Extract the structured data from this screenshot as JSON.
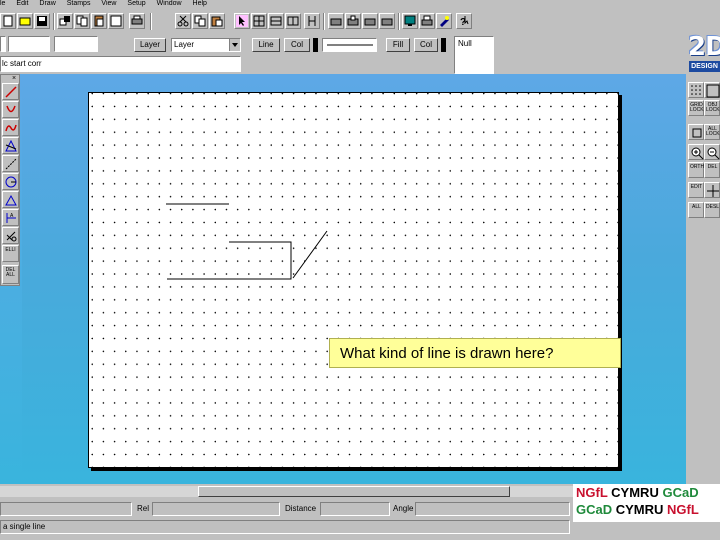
{
  "menu": [
    "le",
    "Edit",
    "Draw",
    "Stamps",
    "View",
    "Setup",
    "Window",
    "Help"
  ],
  "toolbar_row2": {
    "layer_button": "Layer",
    "layer_value": "Layer",
    "line_button": "Line",
    "colour_button": "Col",
    "fill_button": "Fill",
    "fill_colour_button": "Col",
    "fill_value": "Null"
  },
  "address": {
    "value": "lc start corr"
  },
  "logo": {
    "big": "2D",
    "sub": "DESIGN"
  },
  "palette_right": {
    "grid_lock": "GRID LOCK",
    "obj_lock": "OBJ LOCK",
    "all_lock": "ALL LOCK",
    "ortho": "ORTH",
    "delete": "DEL",
    "edit": "EDIT",
    "sel_all": "ALL",
    "sel_desel": "DESL"
  },
  "palette_left": {
    "ellipse": "ELLI",
    "delete_all": "DEL ALL"
  },
  "question": {
    "text": "What kind of line is drawn here?"
  },
  "status": {
    "rel": "Rel",
    "distance": "Distance",
    "angle": "Angle",
    "hint": "a single line"
  },
  "badge": {
    "line1": [
      "NGfL",
      "CYMRU",
      "GCaD"
    ],
    "line2": [
      "GCaD",
      "CYMRU",
      "NGfL"
    ]
  },
  "colors": {
    "paper": "#ffffff",
    "question_bg": "#ffff99",
    "desktop": "#4aa9dc",
    "brand_red": "#c8102e",
    "brand_green": "#1f8a3b"
  }
}
